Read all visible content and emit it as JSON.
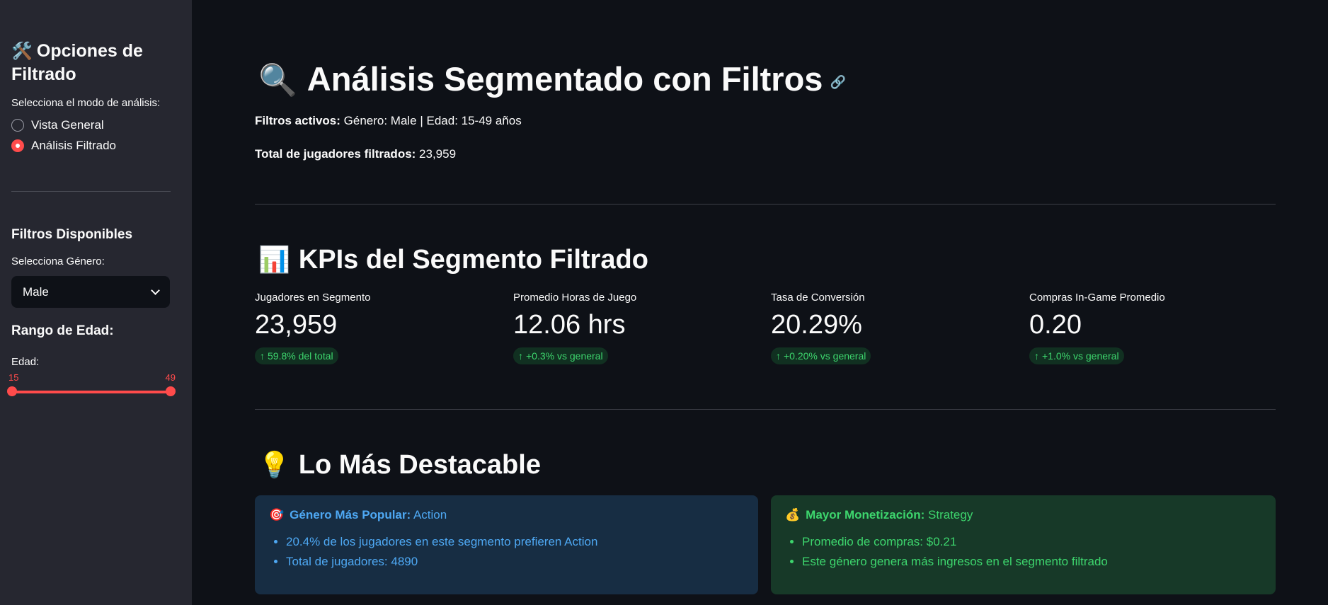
{
  "sidebar": {
    "title_emoji": "🛠️",
    "title": "Opciones de Filtrado",
    "mode_label": "Selecciona el modo de análisis:",
    "modes": [
      {
        "label": "Vista General",
        "selected": false
      },
      {
        "label": "Análisis Filtrado",
        "selected": true
      }
    ],
    "filters_title": "Filtros Disponibles",
    "gender_label": "Selecciona Género:",
    "gender_value": "Male",
    "age_title": "Rango de Edad:",
    "age_label": "Edad:",
    "age_min": "15",
    "age_max": "49"
  },
  "main": {
    "title_emoji": "🔍",
    "title": "Análisis Segmentado con Filtros",
    "active_filters_label": "Filtros activos:",
    "active_filters_value": " Género: Male | Edad: 15-49 años",
    "total_label": "Total de jugadores filtrados:",
    "total_value": " 23,959",
    "kpi_title_emoji": "📊",
    "kpi_title": "KPIs del Segmento Filtrado",
    "metrics": [
      {
        "label": "Jugadores en Segmento",
        "value": "23,959",
        "delta": "59.8% del total"
      },
      {
        "label": "Promedio Horas de Juego",
        "value": "12.06 hrs",
        "delta": "+0.3% vs general"
      },
      {
        "label": "Tasa de Conversión",
        "value": "20.29%",
        "delta": "+0.20% vs general"
      },
      {
        "label": "Compras In-Game Promedio",
        "value": "0.20",
        "delta": "+1.0% vs general"
      }
    ],
    "highlight_title_emoji": "💡",
    "highlight_title": "Lo Más Destacable",
    "cards": [
      {
        "emoji": "🎯",
        "title": "Género Más Popular:",
        "value": " Action",
        "items": [
          "20.4% de los jugadores en este segmento prefieren Action",
          "Total de jugadores: 4890"
        ]
      },
      {
        "emoji": "💰",
        "title": "Mayor Monetización:",
        "value": " Strategy",
        "items": [
          "Promedio de compras: $0.21",
          "Este género genera más ingresos en el segmento filtrado"
        ]
      }
    ]
  },
  "colors": {
    "accent": "#ff4b4b",
    "positive": "#3dd56d",
    "info": "#4ea8f3",
    "background": "#0e1117",
    "sidebar": "#262730"
  }
}
